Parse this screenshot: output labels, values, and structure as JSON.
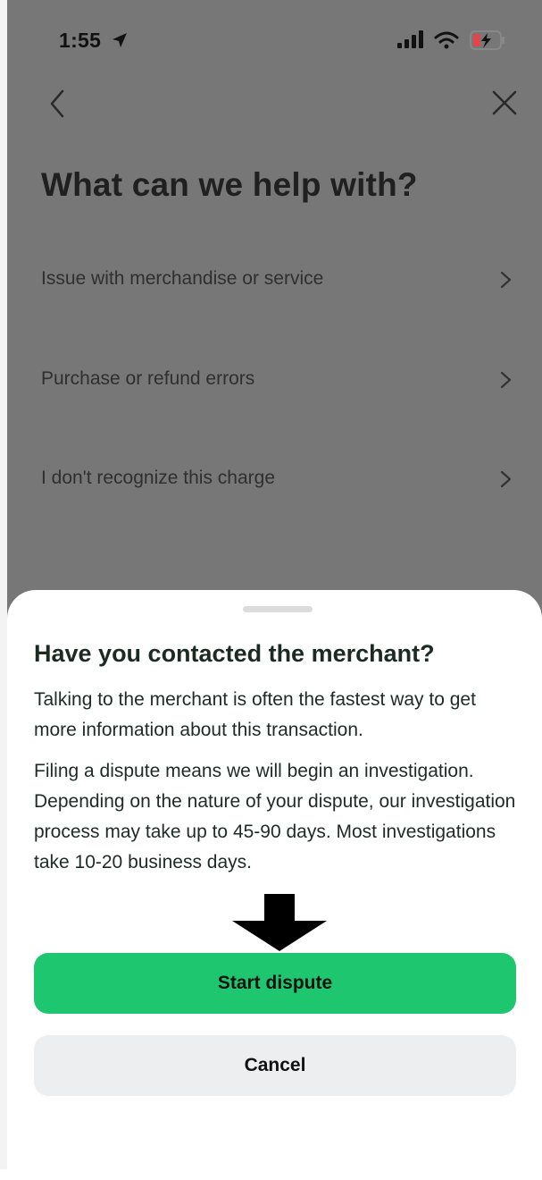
{
  "status_bar": {
    "time": "1:55",
    "icons": [
      "location-arrow-icon",
      "signal-icon",
      "wifi-icon",
      "battery-charging-icon"
    ],
    "battery_color": "#e0464a"
  },
  "header": {
    "back_icon": "chevron-left-icon",
    "close_icon": "close-icon",
    "title": "What can we help with?"
  },
  "menu": {
    "items": [
      {
        "label": "Issue with merchandise or service"
      },
      {
        "label": "Purchase or refund errors"
      },
      {
        "label": "I don't recognize this charge"
      }
    ]
  },
  "sheet": {
    "title": "Have you contacted the merchant?",
    "paragraph1": "Talking to the merchant is often the fastest way to get more information about this transaction.",
    "paragraph2": "Filing a dispute means we will begin an investigation. Depending on the nature of your dispute, our investigation process may take up to 45-90 days. Most investigations take 10-20 business days.",
    "primary_label": "Start dispute",
    "secondary_label": "Cancel",
    "accent_color": "#1dc66f"
  }
}
